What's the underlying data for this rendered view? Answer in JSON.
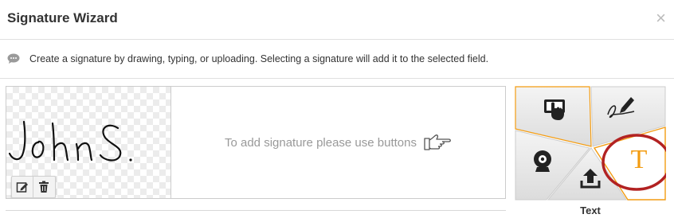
{
  "dialog": {
    "title": "Signature Wizard",
    "close_symbol": "×"
  },
  "info": {
    "icon": "chat-bubble-icon",
    "text": "Create a signature by drawing, typing, or uploading. Selecting a signature will add it to the selected field."
  },
  "preview": {
    "signature_text": "JohnS.",
    "tools": [
      "edit-icon",
      "trash-icon"
    ]
  },
  "hint": {
    "text": "To add signature please use buttons",
    "icon": "pointing-hand-icon"
  },
  "options": {
    "items": [
      {
        "id": "touch",
        "icon": "touch-tablet-icon"
      },
      {
        "id": "draw",
        "icon": "pen-signature-icon"
      },
      {
        "id": "webcam",
        "icon": "webcam-icon"
      },
      {
        "id": "upload",
        "icon": "upload-icon"
      },
      {
        "id": "text",
        "icon": "text-T-icon",
        "glyph": "T",
        "selected": true
      }
    ],
    "selected_label": "Text",
    "accent_color": "#f39c12",
    "highlight_color": "#b22222"
  }
}
